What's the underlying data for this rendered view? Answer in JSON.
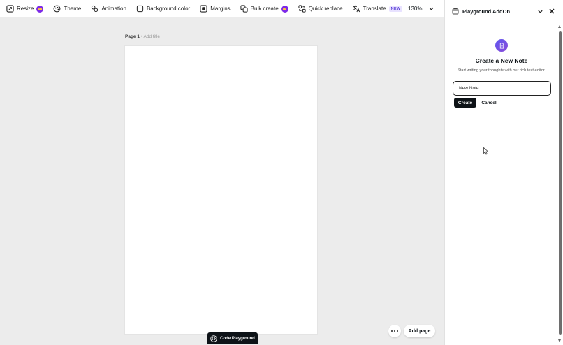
{
  "toolbar": {
    "items": [
      {
        "label": "Resize",
        "icon": "resize-icon",
        "premium": true
      },
      {
        "label": "Theme",
        "icon": "palette-icon"
      },
      {
        "label": "Animation",
        "icon": "animation-icon"
      },
      {
        "label": "Background color",
        "icon": "background-color-icon"
      },
      {
        "label": "Margins",
        "icon": "margins-icon"
      },
      {
        "label": "Bulk create",
        "icon": "bulk-create-icon",
        "premium": true
      },
      {
        "label": "Quick replace",
        "icon": "quick-replace-icon"
      },
      {
        "label": "Translate",
        "icon": "translate-icon",
        "badge": "NEW"
      }
    ],
    "zoom": "130%"
  },
  "canvas": {
    "page_label": "Page 1",
    "page_label_sub": " • Add title"
  },
  "bottom": {
    "add_page": "Add page",
    "code_playground": "Code Playground"
  },
  "panel": {
    "title": "Playground AddOn",
    "heading": "Create a New Note",
    "subtext": "Start writing your thoughts with our rich text editor.",
    "input_value": "New Note",
    "create_label": "Create",
    "cancel_label": "Cancel"
  },
  "colors": {
    "accent": "#7d2ae8",
    "dark": "#0d1216",
    "canvas_bg": "#ececec"
  }
}
